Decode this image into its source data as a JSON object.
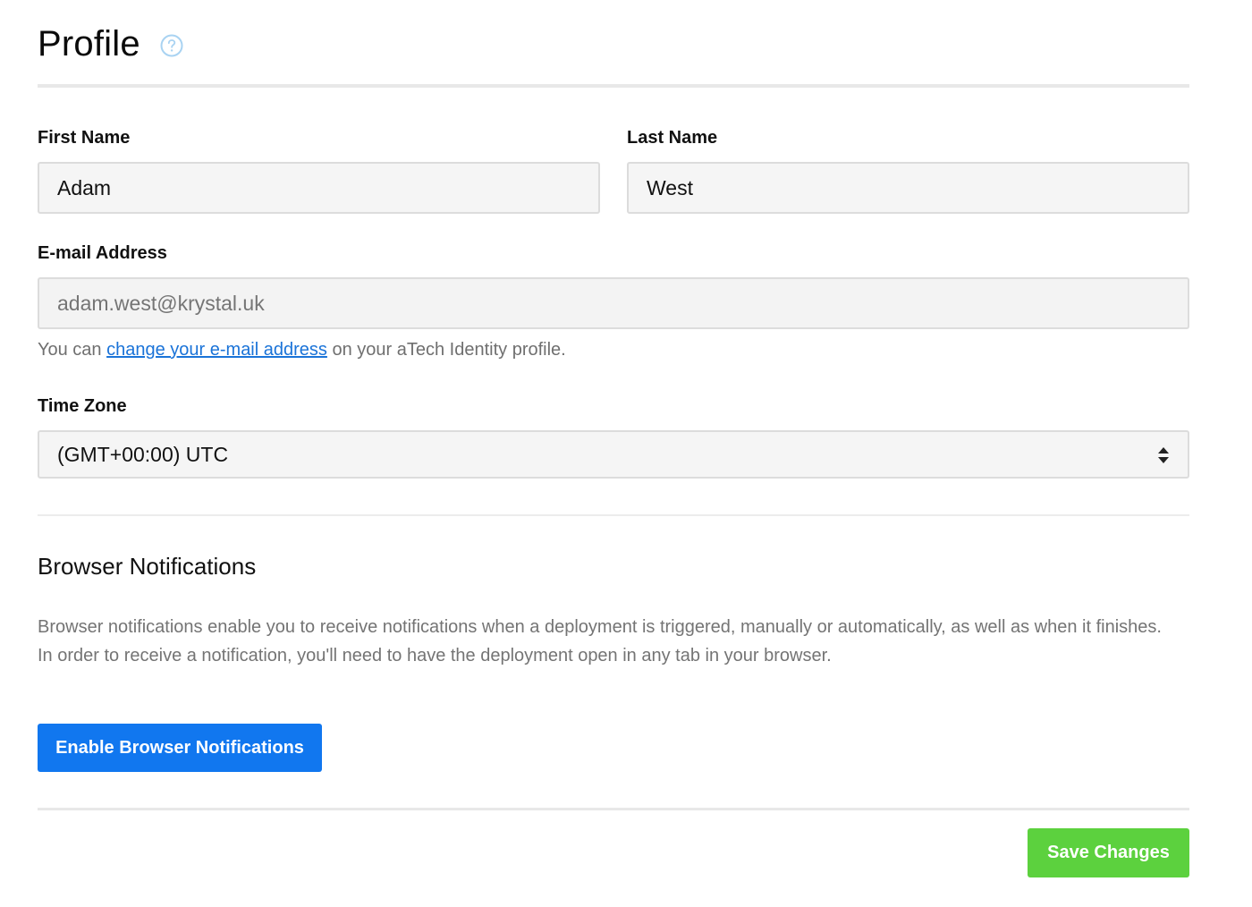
{
  "header": {
    "title": "Profile",
    "help_icon": "question-circle-icon"
  },
  "form": {
    "first_name": {
      "label": "First Name",
      "value": "Adam"
    },
    "last_name": {
      "label": "Last Name",
      "value": "West"
    },
    "email": {
      "label": "E-mail Address",
      "placeholder": "adam.west@krystal.uk",
      "help_prefix": "You can ",
      "help_link": "change your e-mail address",
      "help_suffix": " on your aTech Identity profile."
    },
    "time_zone": {
      "label": "Time Zone",
      "selected": "(GMT+00:00) UTC"
    }
  },
  "notifications": {
    "title": "Browser Notifications",
    "description_line1": "Browser notifications enable you to receive notifications when a deployment is triggered, manually or automatically, as well as when it finishes.",
    "description_line2": "In order to receive a notification, you'll need to have the deployment open in any tab in your browser.",
    "enable_button": "Enable Browser Notifications"
  },
  "footer": {
    "save_button": "Save Changes"
  },
  "colors": {
    "primary": "#1177ef",
    "success": "#5cd13e",
    "link": "#1a73d8",
    "help_icon": "#a9d3f2"
  }
}
